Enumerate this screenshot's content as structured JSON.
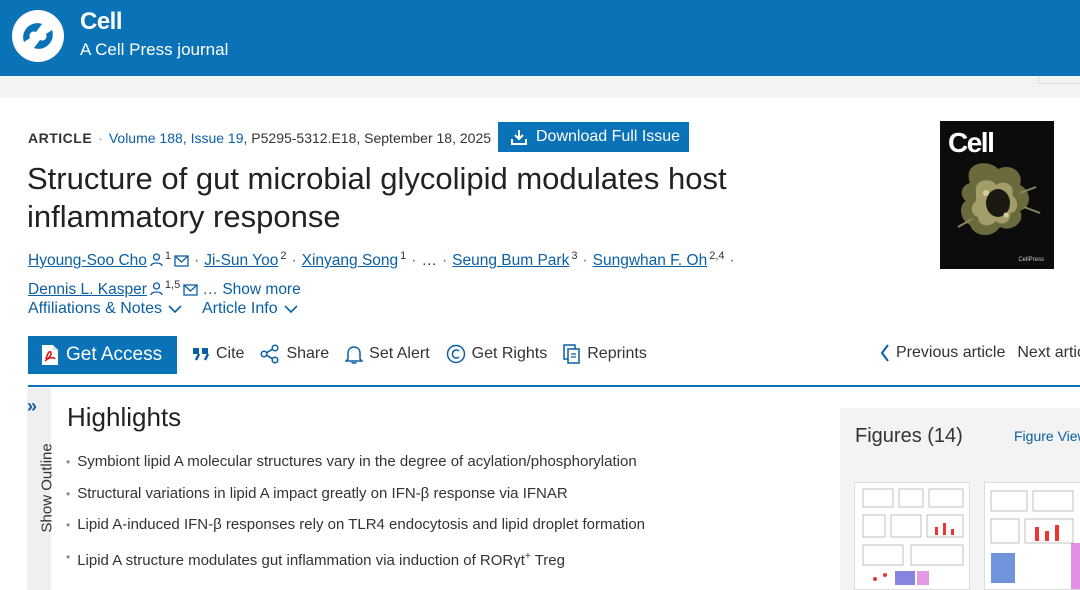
{
  "header": {
    "brand_title": "Cell",
    "brand_sub": "A Cell Press journal"
  },
  "article": {
    "type": "ARTICLE",
    "volume_issue": "Volume 188, Issue 19",
    "pages_date": "P5295-5312.E18, September 18, 2025",
    "download_label": "Download Full Issue",
    "title": "Structure of gut microbial glycolipid modulates host inflammatory response",
    "authors": [
      {
        "name": "Hyoung-Soo Cho",
        "sup": "1"
      },
      {
        "name": "Ji-Sun Yoo",
        "sup": "2"
      },
      {
        "name": "Xinyang Song",
        "sup": "1"
      },
      {
        "name": "Seung Bum Park",
        "sup": "3"
      },
      {
        "name": "Sungwhan F. Oh",
        "sup": "2,4"
      },
      {
        "name": "Dennis L. Kasper",
        "sup": "1,5"
      }
    ],
    "ellipsis": "…",
    "show_more": "… Show more",
    "tabs": [
      "Affiliations & Notes",
      "Article Info"
    ]
  },
  "actions": {
    "get_access": "Get Access",
    "cite": "Cite",
    "share": "Share",
    "set_alert": "Set Alert",
    "get_rights": "Get Rights",
    "reprints": "Reprints",
    "previous": "Previous article",
    "next": "Next artic"
  },
  "cover": {
    "title": "Cell",
    "footer": "CellPress"
  },
  "outline": {
    "label": "Show Outline"
  },
  "highlights": {
    "title": "Highlights",
    "items": [
      "Symbiont lipid A molecular structures vary in the degree of acylation/phosphorylation",
      "Structural variations in lipid A impact greatly on IFN-β response via IFNAR",
      "Lipid A-induced IFN-β responses rely on TLR4 endocytosis and lipid droplet formation",
      "Lipid A structure modulates gut inflammation via induction of RORγt",
      "Treg"
    ],
    "item4_sup": "+"
  },
  "figures": {
    "title": "Figures (14)",
    "view_link": "Figure View"
  },
  "colors": {
    "brand": "#0a72b6",
    "link": "#0a5fa5"
  }
}
